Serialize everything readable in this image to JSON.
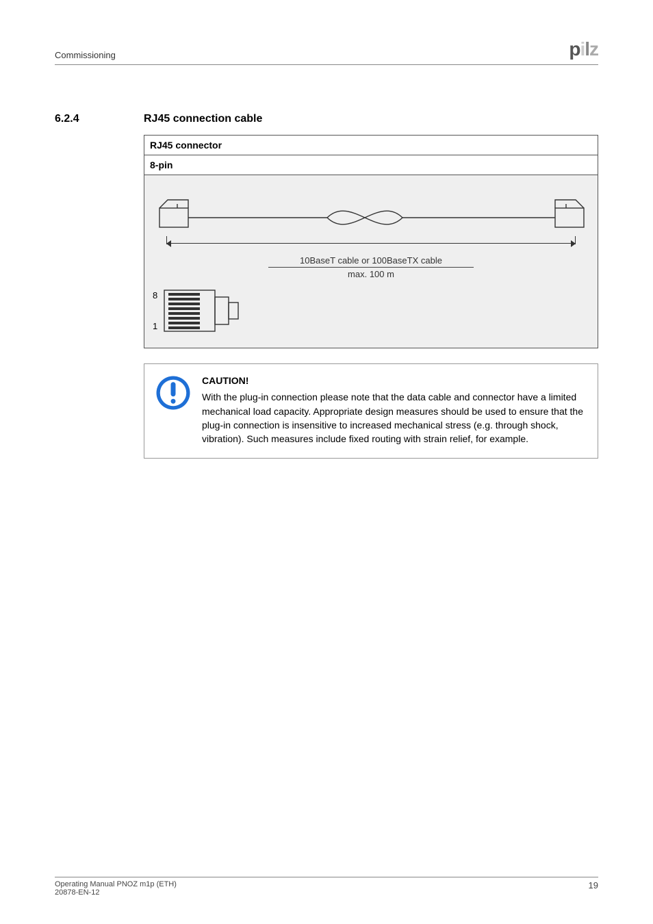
{
  "header": {
    "crumb": "Commissioning",
    "logo": "pilz"
  },
  "section": {
    "number": "6.2.4",
    "title": "RJ45 connection cable"
  },
  "figure": {
    "head1": "RJ45 connector",
    "head2": "8-pin",
    "cable_label_top": "10BaseT cable or 100BaseTX cable",
    "cable_label_bot": "max. 100 m",
    "pin_top": "8",
    "pin_bot": "1"
  },
  "caution": {
    "title": "CAUTION!",
    "body": "With the plug-in connection please note that the data cable and connector have a limited mechanical load capacity. Appropriate design measures should be used to ensure that the plug-in connection is insensitive to increased mechanical stress (e.g. through shock, vibration). Such measures include fixed routing with strain relief, for example."
  },
  "footer": {
    "line1": "Operating Manual PNOZ m1p (ETH)",
    "line2": "20878-EN-12",
    "page": "19"
  }
}
